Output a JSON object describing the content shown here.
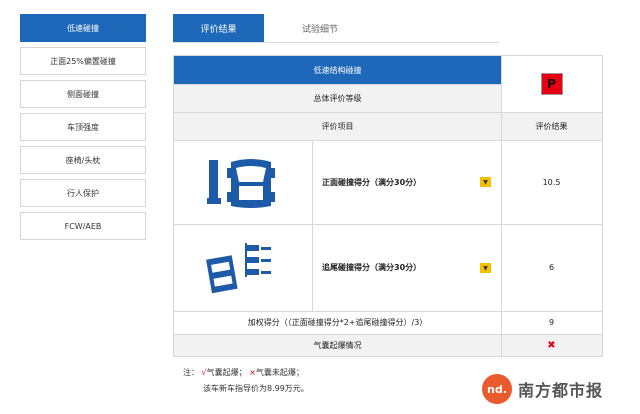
{
  "sidebar": {
    "items": [
      {
        "label": "低速碰撞"
      },
      {
        "label": "正面25%偏置碰撞"
      },
      {
        "label": "侧面碰撞"
      },
      {
        "label": "车顶强度"
      },
      {
        "label": "座椅/头枕"
      },
      {
        "label": "行人保护"
      },
      {
        "label": "FCW/AEB"
      }
    ]
  },
  "tabs": [
    {
      "label": "评价结果"
    },
    {
      "label": "试验细节"
    }
  ],
  "table": {
    "section_title": "低速结构碰撞",
    "overall_label": "总体评价等级",
    "overall_grade": "P",
    "col_item": "评价项目",
    "col_result": "评价结果",
    "rows": [
      {
        "label": "正面碰撞得分（满分30分）",
        "value": "10.5"
      },
      {
        "label": "追尾碰撞得分（满分30分）",
        "value": "6"
      }
    ],
    "weighted_label": "加权得分（（正面碰撞得分*2+追尾碰撞得分）/3）",
    "weighted_value": "9",
    "airbag_label": "气囊起爆情况",
    "airbag_mark": "✖"
  },
  "notes": {
    "prefix": "注：",
    "check_mark": "√",
    "check_text": "气囊起爆；",
    "cross_mark": "×",
    "cross_text": "气囊未起爆；",
    "price_line": "该车新车指导价为8.99万元。"
  },
  "watermark": {
    "logo_text": "nd.",
    "name": "南方都市报"
  },
  "colors": {
    "accent": "#1d68b8",
    "grade_badge": "#e60012",
    "dropdown": "#f3c000",
    "car_icon": "#1d5aa8"
  }
}
